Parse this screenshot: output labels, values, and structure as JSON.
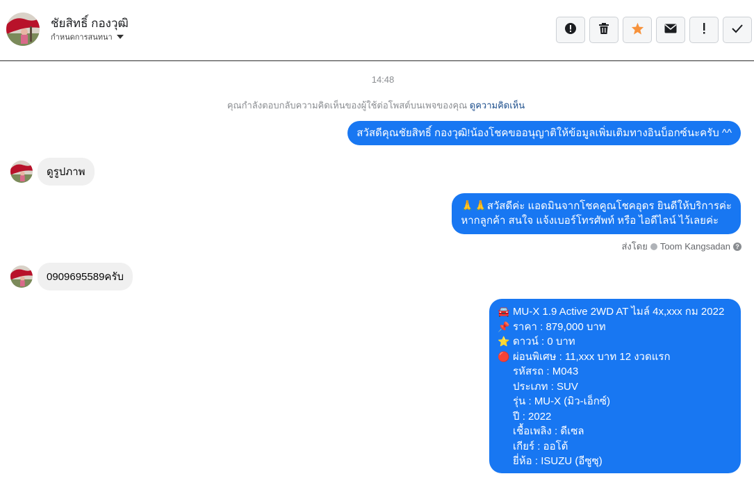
{
  "header": {
    "name": "ชัยสิทธิ์ กองวุฒิ",
    "assign_label": "กำหนดการสนทนา"
  },
  "toolbar": {
    "icons": [
      "report-icon",
      "trash-icon",
      "star-icon",
      "mail-icon",
      "exclamation-icon",
      "check-icon"
    ],
    "star_color": "#f7923b"
  },
  "chat": {
    "timestamp": "14:48",
    "context_text": "คุณกำลังตอบกลับความคิดเห็นของผู้ใช้ต่อโพสต์บนเพจของคุณ",
    "context_link": "ดูความคิดเห็น",
    "messages": {
      "out_1": "สวัสดีคุณชัยสิทธิ์ กองวุฒิ!น้องโชคขออนุญาติให้ข้อมูลเพิ่มเติมทางอินบ็อกซ์นะครับ ^^",
      "in_1": "ดูรูปภาพ",
      "out_2_line1": "🙏🙏สวัสดีค่ะ แอดมินจากโชคคูณโชคอุดร ยินดีให้บริการค่ะ",
      "out_2_line2": "หากลูกค้า สนใจ แจ้งเบอร์โทรศัพท์ หรือ ไอดีไลน์  ไว้เลยค่ะ",
      "in_2": "0909695589ครับ"
    },
    "sent_by_label": "ส่งโดย",
    "sent_by_name": "Toom Kangsadan",
    "listing": [
      {
        "emoji": "🚘",
        "text": "MU-X 1.9 Active 2WD AT ไมล์ 4x,xxx กม 2022"
      },
      {
        "emoji": "📌",
        "text": "ราคา : 879,000 บาท"
      },
      {
        "emoji": "⭐",
        "text": "ดาวน์ : 0 บาท"
      },
      {
        "emoji": "🔴",
        "text": " ผ่อนพิเศษ : 11,xxx บาท 12 งวดแรก"
      },
      {
        "emoji": "",
        "text": "รหัสรถ : M043"
      },
      {
        "emoji": "",
        "text": "ประเภท : SUV"
      },
      {
        "emoji": "",
        "text": "รุ่น : MU-X (มิว-เอ็กซ์)"
      },
      {
        "emoji": "",
        "text": "ปี : 2022"
      },
      {
        "emoji": "",
        "text": "เชื้อเพลิง : ดีเซล"
      },
      {
        "emoji": "",
        "text": "เกียร์ : ออโต้"
      },
      {
        "emoji": "",
        "text": "ยี่ห้อ : ISUZU (อีซูซุ)"
      }
    ]
  },
  "colors": {
    "outgoing_bubble": "#1877f2",
    "incoming_bubble": "#f0f0f0"
  }
}
